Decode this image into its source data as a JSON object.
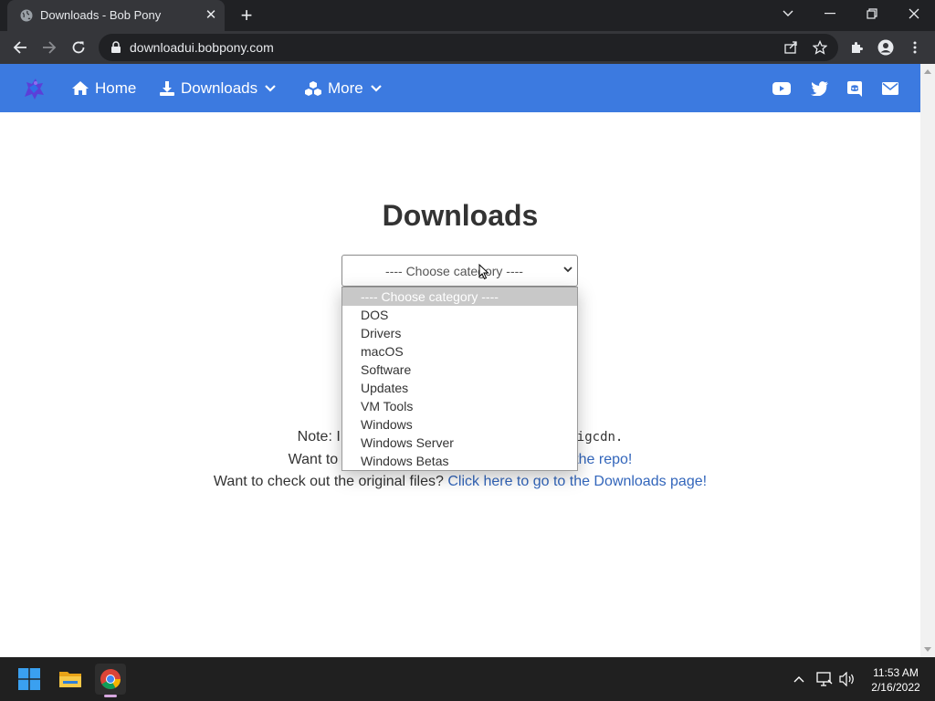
{
  "browser": {
    "tab_title": "Downloads - Bob Pony",
    "url": "downloadui.bobpony.com"
  },
  "site_nav": {
    "home": "Home",
    "downloads": "Downloads",
    "more": "More"
  },
  "main": {
    "title": "Downloads",
    "select": {
      "selected": "---- Choose category ----",
      "options": [
        "---- Choose category ----",
        "DOS",
        "Drivers",
        "macOS",
        "Software",
        "Updates",
        "VM Tools",
        "Windows",
        "Windows Server",
        "Windows Betas"
      ]
    },
    "notes": {
      "line1_prefix": "Note: I",
      "line1_suffix": "igcdn.",
      "line2_prefix": "Want to",
      "line2_link": "the repo!",
      "line3_text": "Want to check out the original files?",
      "line3_link": "Click here to go to the Downloads page!"
    }
  },
  "taskbar": {
    "time": "11:53 AM",
    "date": "2/16/2022"
  },
  "colors": {
    "nav_blue": "#3c7ae0",
    "link": "#3366bb",
    "chrome_dark": "#202124"
  }
}
